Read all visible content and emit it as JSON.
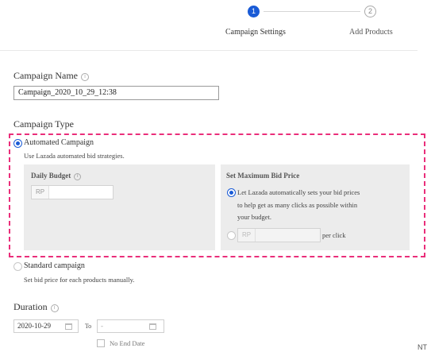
{
  "stepper": {
    "step1_number": "1",
    "step1_label": "Campaign Settings",
    "step2_number": "2",
    "step2_label": "Add Products"
  },
  "campaign_name": {
    "label": "Campaign Name",
    "value": "Campaign_2020_10_29_12:38"
  },
  "campaign_type": {
    "label": "Campaign Type",
    "automated": {
      "label": "Automated Campaign",
      "description": "Use Lazada automated bid strategies.",
      "selected": true
    },
    "daily_budget": {
      "label": "Daily Budget",
      "prefix": "RP",
      "value": ""
    },
    "max_bid": {
      "label": "Set Maximum Bid Price",
      "auto_line1": "Let Lazada automatically sets your bid prices",
      "auto_line2": "to help get as many clicks as possible within",
      "auto_line3": "your budget.",
      "manual_prefix": "RP",
      "manual_suffix": "per click"
    },
    "standard": {
      "label": "Standard campaign",
      "description": "Set bid price for each products manually.",
      "selected": false
    }
  },
  "duration": {
    "label": "Duration",
    "start_date": "2020-10-29",
    "to_label": "To",
    "end_date": "-",
    "no_end_date_label": "No End Date"
  },
  "side_text": "NT",
  "colors": {
    "accent": "#1a5bd6",
    "highlight_dash": "#ea2e7a",
    "panel_bg": "#ececec"
  }
}
